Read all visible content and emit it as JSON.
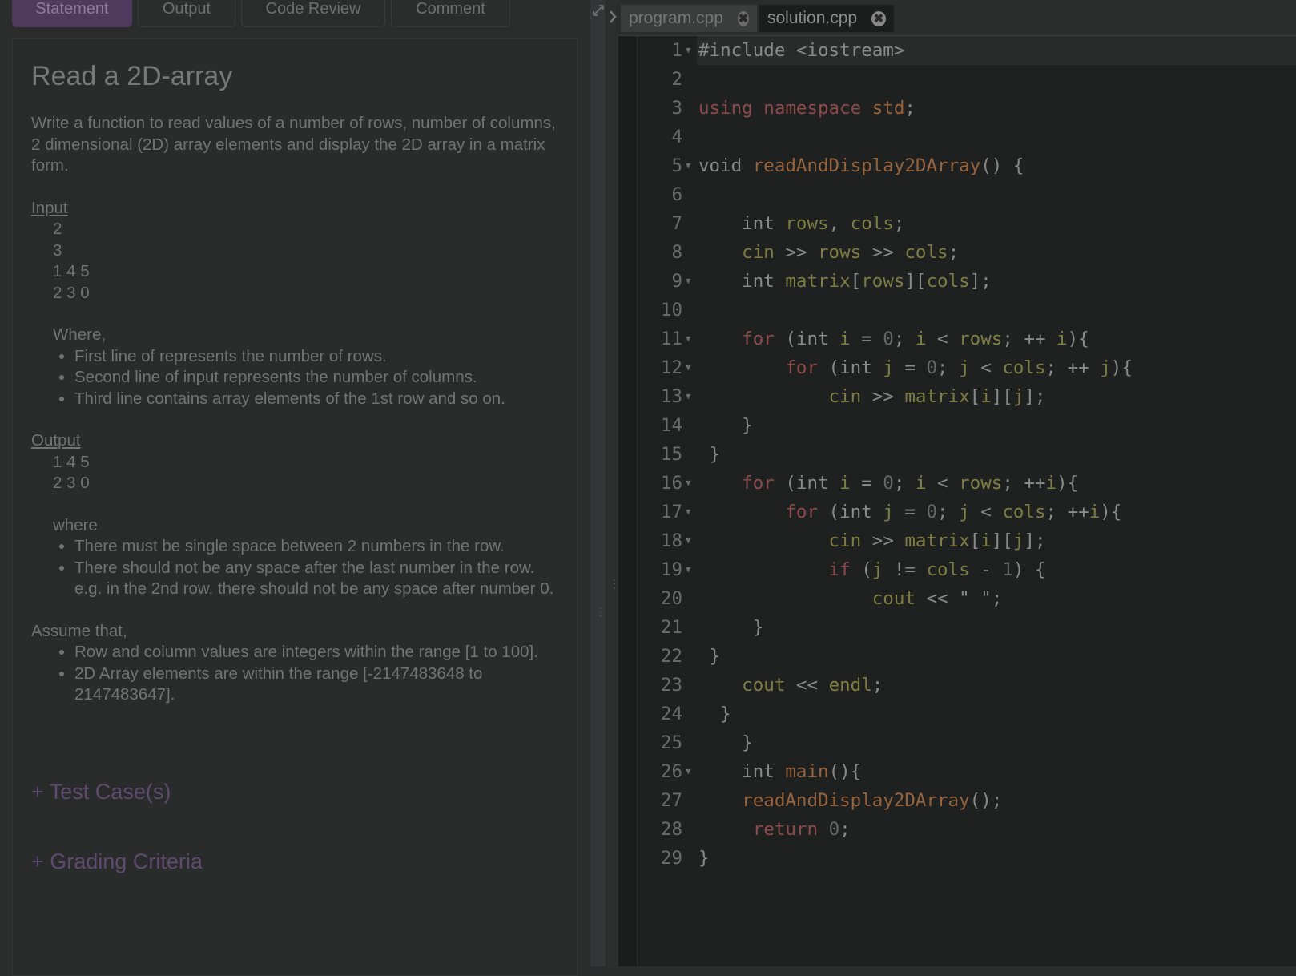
{
  "left_tabs": [
    "Statement",
    "Output",
    "Code Review",
    "Comment"
  ],
  "problem": {
    "title": "Read a 2D-array",
    "description": "Write a function to read values of a number of rows, number of columns, 2 dimensional (2D) array elements and display the 2D array in a matrix form.",
    "input_label": "Input",
    "input_lines": [
      "2",
      "3",
      "1 4 5",
      "2 3 0"
    ],
    "input_where": "Where,",
    "input_bullets": [
      "First line of represents the number of rows.",
      "Second line of input represents the number of columns.",
      "Third line contains array elements of the 1st row and so on."
    ],
    "output_label": "Output",
    "output_lines": [
      "1 4 5",
      "2 3 0"
    ],
    "output_where": "where",
    "output_bullets": [
      "There must be single space between 2 numbers in the row.",
      "There should not be any space after the last number in the row. e.g. in the 2nd row, there should not be any space after number 0."
    ],
    "assume_label": "Assume that,",
    "assume_bullets": [
      "Row and column values are integers within the range [1 to 100].",
      "2D Array elements are within the range [-2147483648 to 2147483647]."
    ],
    "test_cases": "+ Test Case(s)",
    "grading": "+ Grading Criteria"
  },
  "editor": {
    "tabs": [
      {
        "label": "program.cpp",
        "active": false
      },
      {
        "label": "solution.cpp",
        "active": true
      }
    ],
    "close_glyph": "✖",
    "lines": [
      {
        "fold": true,
        "tokens": [
          [
            "d",
            "#include <iostream>"
          ]
        ]
      },
      {
        "fold": false,
        "tokens": []
      },
      {
        "fold": false,
        "tokens": [
          [
            "k",
            "using namespace "
          ],
          [
            "f",
            "std"
          ],
          [
            "d",
            ";"
          ]
        ]
      },
      {
        "fold": false,
        "tokens": []
      },
      {
        "fold": true,
        "tokens": [
          [
            "d",
            "void "
          ],
          [
            "f",
            "readAndDisplay2DArray"
          ],
          [
            "d",
            "() {"
          ]
        ]
      },
      {
        "fold": false,
        "tokens": []
      },
      {
        "fold": false,
        "tokens": [
          [
            "d",
            "    int "
          ],
          [
            "v",
            "rows"
          ],
          [
            "d",
            ", "
          ],
          [
            "v",
            "cols"
          ],
          [
            "d",
            ";"
          ]
        ]
      },
      {
        "fold": false,
        "tokens": [
          [
            "v",
            "    cin"
          ],
          [
            "d",
            " >> "
          ],
          [
            "v",
            "rows"
          ],
          [
            "d",
            " >> "
          ],
          [
            "v",
            "cols"
          ],
          [
            "d",
            ";"
          ]
        ]
      },
      {
        "fold": true,
        "tokens": [
          [
            "d",
            "    int "
          ],
          [
            "v",
            "matrix"
          ],
          [
            "d",
            "["
          ],
          [
            "v",
            "rows"
          ],
          [
            "d",
            "]["
          ],
          [
            "v",
            "cols"
          ],
          [
            "d",
            "];"
          ]
        ]
      },
      {
        "fold": false,
        "tokens": []
      },
      {
        "fold": true,
        "tokens": [
          [
            "k",
            "    for"
          ],
          [
            "d",
            " (int "
          ],
          [
            "v",
            "i"
          ],
          [
            "d",
            " = "
          ],
          [
            "n",
            "0"
          ],
          [
            "d",
            "; "
          ],
          [
            "v",
            "i"
          ],
          [
            "d",
            " < "
          ],
          [
            "v",
            "rows"
          ],
          [
            "d",
            "; ++ "
          ],
          [
            "v",
            "i"
          ],
          [
            "d",
            "){"
          ]
        ]
      },
      {
        "fold": true,
        "tokens": [
          [
            "k",
            "        for"
          ],
          [
            "d",
            " (int "
          ],
          [
            "v",
            "j"
          ],
          [
            "d",
            " = "
          ],
          [
            "n",
            "0"
          ],
          [
            "d",
            "; "
          ],
          [
            "v",
            "j"
          ],
          [
            "d",
            " < "
          ],
          [
            "v",
            "cols"
          ],
          [
            "d",
            "; ++ "
          ],
          [
            "v",
            "j"
          ],
          [
            "d",
            "){"
          ]
        ]
      },
      {
        "fold": true,
        "tokens": [
          [
            "v",
            "            cin"
          ],
          [
            "d",
            " >> "
          ],
          [
            "v",
            "matrix"
          ],
          [
            "d",
            "["
          ],
          [
            "v",
            "i"
          ],
          [
            "d",
            "]["
          ],
          [
            "v",
            "j"
          ],
          [
            "d",
            "];"
          ]
        ]
      },
      {
        "fold": false,
        "tokens": [
          [
            "d",
            "    }"
          ]
        ]
      },
      {
        "fold": false,
        "tokens": [
          [
            "d",
            " }"
          ]
        ]
      },
      {
        "fold": true,
        "tokens": [
          [
            "k",
            "    for"
          ],
          [
            "d",
            " (int "
          ],
          [
            "v",
            "i"
          ],
          [
            "d",
            " = "
          ],
          [
            "n",
            "0"
          ],
          [
            "d",
            "; "
          ],
          [
            "v",
            "i"
          ],
          [
            "d",
            " < "
          ],
          [
            "v",
            "rows"
          ],
          [
            "d",
            "; ++"
          ],
          [
            "v",
            "i"
          ],
          [
            "d",
            "){"
          ]
        ]
      },
      {
        "fold": true,
        "tokens": [
          [
            "k",
            "        for"
          ],
          [
            "d",
            " (int "
          ],
          [
            "v",
            "j"
          ],
          [
            "d",
            " = "
          ],
          [
            "n",
            "0"
          ],
          [
            "d",
            "; "
          ],
          [
            "v",
            "j"
          ],
          [
            "d",
            " < "
          ],
          [
            "v",
            "cols"
          ],
          [
            "d",
            "; ++"
          ],
          [
            "v",
            "i"
          ],
          [
            "d",
            "){"
          ]
        ]
      },
      {
        "fold": true,
        "tokens": [
          [
            "v",
            "            cin"
          ],
          [
            "d",
            " >> "
          ],
          [
            "v",
            "matrix"
          ],
          [
            "d",
            "["
          ],
          [
            "v",
            "i"
          ],
          [
            "d",
            "]["
          ],
          [
            "v",
            "j"
          ],
          [
            "d",
            "];"
          ]
        ]
      },
      {
        "fold": true,
        "tokens": [
          [
            "k",
            "            if"
          ],
          [
            "d",
            " ("
          ],
          [
            "v",
            "j"
          ],
          [
            "d",
            " != "
          ],
          [
            "v",
            "cols"
          ],
          [
            "d",
            " - "
          ],
          [
            "n",
            "1"
          ],
          [
            "d",
            ") {"
          ]
        ]
      },
      {
        "fold": false,
        "tokens": [
          [
            "v",
            "                cout"
          ],
          [
            "d",
            " << \" \";"
          ]
        ]
      },
      {
        "fold": false,
        "tokens": [
          [
            "d",
            "     }"
          ]
        ]
      },
      {
        "fold": false,
        "tokens": [
          [
            "d",
            " }"
          ]
        ]
      },
      {
        "fold": false,
        "tokens": [
          [
            "v",
            "    cout"
          ],
          [
            "d",
            " << "
          ],
          [
            "v",
            "endl"
          ],
          [
            "d",
            ";"
          ]
        ]
      },
      {
        "fold": false,
        "tokens": [
          [
            "d",
            "  }"
          ]
        ]
      },
      {
        "fold": false,
        "tokens": [
          [
            "d",
            "    }"
          ]
        ]
      },
      {
        "fold": true,
        "tokens": [
          [
            "d",
            "    int "
          ],
          [
            "f",
            "main"
          ],
          [
            "d",
            "(){"
          ]
        ]
      },
      {
        "fold": false,
        "tokens": [
          [
            "f",
            "    readAndDisplay2DArray"
          ],
          [
            "d",
            "();"
          ]
        ]
      },
      {
        "fold": false,
        "tokens": [
          [
            "k",
            "     return "
          ],
          [
            "n",
            "0"
          ],
          [
            "d",
            ";"
          ]
        ]
      },
      {
        "fold": false,
        "tokens": [
          [
            "d",
            "}"
          ]
        ]
      }
    ]
  }
}
